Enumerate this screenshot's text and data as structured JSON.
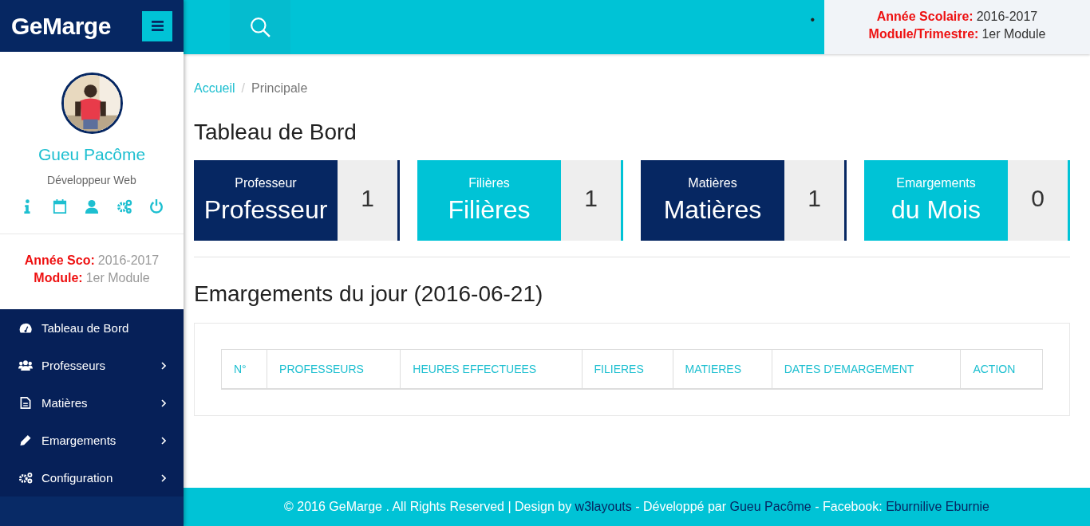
{
  "brand": {
    "title": "GeMarge"
  },
  "profile": {
    "name": "Gueu Pacôme",
    "role": "Développeur Web"
  },
  "session": [
    {
      "label": "Année Sco:",
      "value": "2016-2017"
    },
    {
      "label": "Module:",
      "value": "1er Module"
    }
  ],
  "menu": [
    {
      "label": "Tableau de Bord",
      "has_submenu": false
    },
    {
      "label": "Professeurs",
      "has_submenu": true
    },
    {
      "label": "Matières",
      "has_submenu": true
    },
    {
      "label": "Emargements",
      "has_submenu": true
    },
    {
      "label": "Configuration",
      "has_submenu": true
    }
  ],
  "topbar": {
    "bullet": "•",
    "session": [
      {
        "label": "Année Scolaire:",
        "value": "2016-2017"
      },
      {
        "label": "Module/Trimestre:",
        "value": "1er Module"
      }
    ]
  },
  "breadcrumb": [
    {
      "label": "Accueil",
      "selected": false
    },
    {
      "label": "Principale",
      "selected": true
    }
  ],
  "separator": "/",
  "title": "Tableau de Bord",
  "cards": [
    {
      "caption": "Professeur",
      "label": "Professeur",
      "count": "1",
      "color": "#062762"
    },
    {
      "caption": "Filières",
      "label": "Filières",
      "count": "1",
      "color": "#00c3d6"
    },
    {
      "caption": "Matières",
      "label": "Matières",
      "count": "1",
      "color": "#062762"
    },
    {
      "caption": "Emargements",
      "label": "du Mois",
      "count": "0",
      "color": "#00c3d6"
    }
  ],
  "section_title": "Emargements du jour (2016-06-21)",
  "table": {
    "columns": [
      "N°",
      "PROFESSEURS",
      "HEURES EFFECTUEES",
      "FILIERES",
      "MATIERES",
      "DATES D'EMARGEMENT",
      "ACTION"
    ]
  },
  "footer": [
    {
      "text": "© 2016 GeMarge . All Rights Reserved | Design by ",
      "link": false
    },
    {
      "text": "w3layouts",
      "link": true
    },
    {
      "text": " - Développé par ",
      "link": false
    },
    {
      "text": "Gueu Pacôme",
      "link": true
    },
    {
      "text": " - Facebook: ",
      "link": false
    },
    {
      "text": "Eburnilive Eburnie",
      "link": true
    }
  ]
}
